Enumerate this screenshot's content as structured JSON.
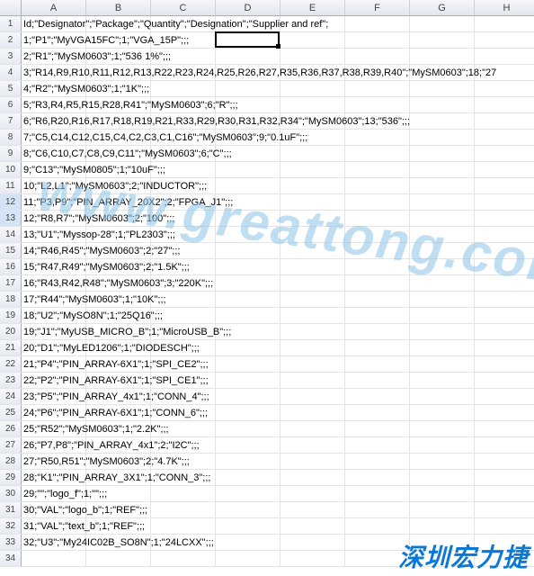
{
  "columns": [
    "A",
    "B",
    "C",
    "D",
    "E",
    "F",
    "G",
    "H"
  ],
  "rows": [
    "Id;\"Designator\";\"Package\";\"Quantity\";\"Designation\";\"Supplier and ref\";",
    "1;\"P1\";\"MyVGA15FC\";1;\"VGA_15P\";;;",
    "2;\"R1\";\"MySM0603\";1;\"536 1%\";;;",
    "3;\"R14,R9,R10,R11,R12,R13,R22,R23,R24,R25,R26,R27,R35,R36,R37,R38,R39,R40\";\"MySM0603\";18;\"27",
    "4;\"R2\";\"MySM0603\";1;\"1K\";;;",
    "5;\"R3,R4,R5,R15,R28,R41\";\"MySM0603\";6;\"R\";;;",
    "6;\"R6,R20,R16,R17,R18,R19,R21,R33,R29,R30,R31,R32,R34\";\"MySM0603\";13;\"536\";;;",
    "7;\"C5,C14,C12,C15,C4,C2,C3,C1,C16\";\"MySM0603\";9;\"0.1uF\";;;",
    "8;\"C6,C10,C7,C8,C9,C11\";\"MySM0603\";6;\"C\";;;",
    "9;\"C13\";\"MySM0805\";1;\"10uF\";;;",
    "10;\"L2,L1\";\"MySM0603\";2;\"INDUCTOR\";;;",
    "11;\"P3,P9\";\"PIN_ARRAY_20X2\";2;\"FPGA_J1\";;;",
    "12;\"R8,R7\";\"MySM0603\";2;\"100\";;;",
    "13;\"U1\";\"Myssop-28\";1;\"PL2303\";;;",
    "14;\"R46,R45\";\"MySM0603\";2;\"27\";;;",
    "15;\"R47,R49\";\"MySM0603\";2;\"1.5K\";;;",
    "16;\"R43,R42,R48\";\"MySM0603\";3;\"220K\";;;",
    "17;\"R44\";\"MySM0603\";1;\"10K\";;;",
    "18;\"U2\";\"MySO8N\";1;\"25Q16\";;;",
    "19;\"J1\";\"MyUSB_MICRO_B\";1;\"MicroUSB_B\";;;",
    "20;\"D1\";\"MyLED1206\";1;\"DIODESCH\";;;",
    "21;\"P4\";\"PIN_ARRAY-6X1\";1;\"SPI_CE2\";;;",
    "22;\"P2\";\"PIN_ARRAY-6X1\";1;\"SPI_CE1\";;;",
    "23;\"P5\";\"PIN_ARRAY_4x1\";1;\"CONN_4\";;;",
    "24;\"P6\";\"PIN_ARRAY-6X1\";1;\"CONN_6\";;;",
    "25;\"R52\";\"MySM0603\";1;\"2.2K\";;;",
    "26;\"P7,P8\";\"PIN_ARRAY_4x1\";2;\"I2C\";;;",
    "27;\"R50,R51\";\"MySM0603\";2;\"4.7K\";;;",
    "28;\"K1\";\"PIN_ARRAY_3X1\";1;\"CONN_3\";;;",
    "29;\"\";\"logo_f\";1;\"\";;;",
    "30;\"VAL\";\"logo_b\";1;\"REF\";;;",
    "31;\"VAL\";\"text_b\";1;\"REF\";;;",
    "32;\"U3\";\"My24IC02B_SO8N\";1;\"24LCXX\";;;",
    ""
  ],
  "activeCell": {
    "row": 2,
    "col": "D"
  },
  "watermark": "www.greattong.com",
  "brand": "深圳宏力捷"
}
